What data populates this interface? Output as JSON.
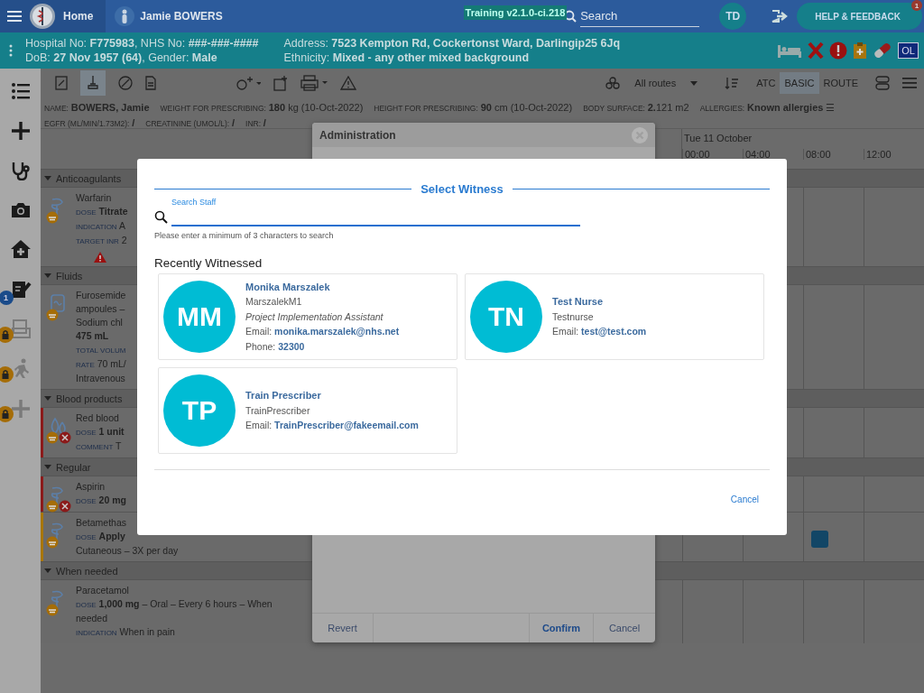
{
  "topbar": {
    "home": "Home",
    "patient": "Jamie BOWERS",
    "version": "Training v2.1.0-ci.218",
    "search": {
      "placeholder": "Search"
    },
    "user": "TD",
    "help": {
      "label": "HELP & FEEDBACK",
      "badge": "1"
    }
  },
  "banner": {
    "columns": [
      [
        "Hospital No: **F775983**, NHS No: **###-###-####**",
        "DoB: **27 Nov 1957 (64)**, Gender: **Male**"
      ],
      [
        "Address: **7523 Kempton Rd, Cockertonst Ward, Darlingip25 6Jq**",
        "Ethnicity: **Mixed - any other mixed background**"
      ]
    ],
    "badge": "OL"
  },
  "sidebar": {
    "items": [
      {
        "kind": "list",
        "locked": false
      },
      {
        "kind": "add",
        "locked": false
      },
      {
        "kind": "stethoscope",
        "locked": false
      },
      {
        "kind": "camera",
        "locked": false
      },
      {
        "kind": "home",
        "locked": false
      },
      {
        "kind": "edit",
        "badge": "1",
        "locked": false
      },
      {
        "kind": "notes",
        "locked": true
      },
      {
        "kind": "walk",
        "locked": true
      },
      {
        "kind": "plus",
        "locked": true
      }
    ]
  },
  "toolbar": {
    "routes": "All routes",
    "views": [
      {
        "label": "ATC",
        "selected": false
      },
      {
        "label": "BASIC",
        "selected": true
      },
      {
        "label": "ROUTE",
        "selected": false
      }
    ]
  },
  "info": [
    {
      "label": "NAME:",
      "value": "**BOWERS, Jamie**"
    },
    {
      "label": "WEIGHT FOR PRESCRIBING:",
      "value": "**180** kg (10-Oct-2022)"
    },
    {
      "label": "HEIGHT FOR PRESCRIBING:",
      "value": "**90** cm (10-Oct-2022)"
    },
    {
      "label": "BODY SURFACE:",
      "value": "**2.**121 m2"
    },
    {
      "label": "ALLERGIES:",
      "value": "**Known allergies** ☰"
    },
    {
      "label": "EGFR (ML/MIN/1.73M2):",
      "value": "**/**"
    },
    {
      "label": "CREATININE (UMOL/L):",
      "value": "**/**"
    },
    {
      "label": "INR:",
      "value": "**/**"
    }
  ],
  "timeline": {
    "date": "Tue 11 October",
    "times": [
      "00:00",
      "04:00",
      "08:00",
      "12:00"
    ]
  },
  "sections": [
    {
      "title": "Anticoagulants",
      "expanded": true,
      "meds": [
        {
          "kind": "drug",
          "name": "Warfarin",
          "cancelled": false,
          "alert": true,
          "lines": [
            {
              "label": "DOSE",
              "text": "**Titrate**"
            },
            {
              "label": "INDICATION",
              "text": "A"
            },
            {
              "label": "TARGET INR",
              "text": "2"
            }
          ]
        }
      ]
    },
    {
      "title": "Fluids",
      "expanded": true,
      "meds": [
        {
          "kind": "fluid",
          "name": "Furosemide",
          "cancelled": false,
          "alert": false,
          "lines": [
            {
              "text": "ampoules –"
            },
            {
              "text": "Sodium chl"
            },
            {
              "text": "**475 mL**"
            },
            {
              "label": "TOTAL VOLUM"
            },
            {
              "label": "RATE",
              "text": "70 mL/"
            },
            {
              "text": "Intravenous"
            }
          ]
        }
      ]
    },
    {
      "title": "Blood products",
      "expanded": true,
      "meds": [
        {
          "kind": "blood",
          "name": "Red blood",
          "color": "#8b1a1a",
          "cancelled": true,
          "alert": false,
          "lines": [
            {
              "label": "DOSE",
              "text": "**1 unit**"
            },
            {
              "label": "COMMENT",
              "text": "T"
            }
          ]
        }
      ]
    },
    {
      "title": "Regular",
      "expanded": true,
      "meds": [
        {
          "kind": "drug",
          "name": "Aspirin",
          "color": "#8b1a1a",
          "cancelled": true,
          "alert": false,
          "lines": [
            {
              "label": "DOSE",
              "text": "**20 mg**"
            }
          ]
        },
        {
          "kind": "drug",
          "name": "Betamethas",
          "color": "#a8760a",
          "cancelled": false,
          "alert": false,
          "dose_marker": true,
          "lines": [
            {
              "label": "DOSE",
              "text": "**Apply**"
            },
            {
              "text": "Cutaneous – 3X per day"
            }
          ]
        }
      ]
    },
    {
      "title": "When needed",
      "expanded": true,
      "meds": [
        {
          "kind": "drug",
          "name": "Paracetamol",
          "cancelled": false,
          "alert": false,
          "lines": [
            {
              "label": "DOSE",
              "text": "**1,000 mg** – Oral – Every 6 hours – When needed"
            },
            {
              "label": "INDICATION",
              "text": "When in pain"
            }
          ]
        }
      ]
    }
  ],
  "admin_dialog": {
    "title": "Administration",
    "buttons": [
      {
        "label": "Revert",
        "kind": "plain"
      },
      {
        "label": "Confirm",
        "kind": "primary"
      },
      {
        "label": "Cancel",
        "kind": "plain"
      }
    ]
  },
  "witness_dialog": {
    "title": "Select Witness",
    "search": {
      "label": "Search Staff",
      "hint": "Please enter a minimum of 3 characters to search"
    },
    "heading": "Recently Witnessed",
    "staff": [
      {
        "initials": "MM",
        "name": "Monika Marszalek",
        "username": "MarszalekM1",
        "role": "Project Implementation Assistant",
        "details": [
          {
            "label": "Email:",
            "value": "monika.marszalek@nhs.net"
          },
          {
            "label": "Phone:",
            "value": "32300"
          }
        ]
      },
      {
        "initials": "TN",
        "name": "Test Nurse",
        "username": "Testnurse",
        "details": [
          {
            "label": "Email:",
            "value": "test@test.com"
          }
        ]
      },
      {
        "initials": "TP",
        "name": "Train Prescriber",
        "username": "TrainPrescriber",
        "details": [
          {
            "label": "Email:",
            "value": "TrainPrescriber@fakeemail.com"
          }
        ]
      }
    ],
    "cancel": "Cancel"
  }
}
